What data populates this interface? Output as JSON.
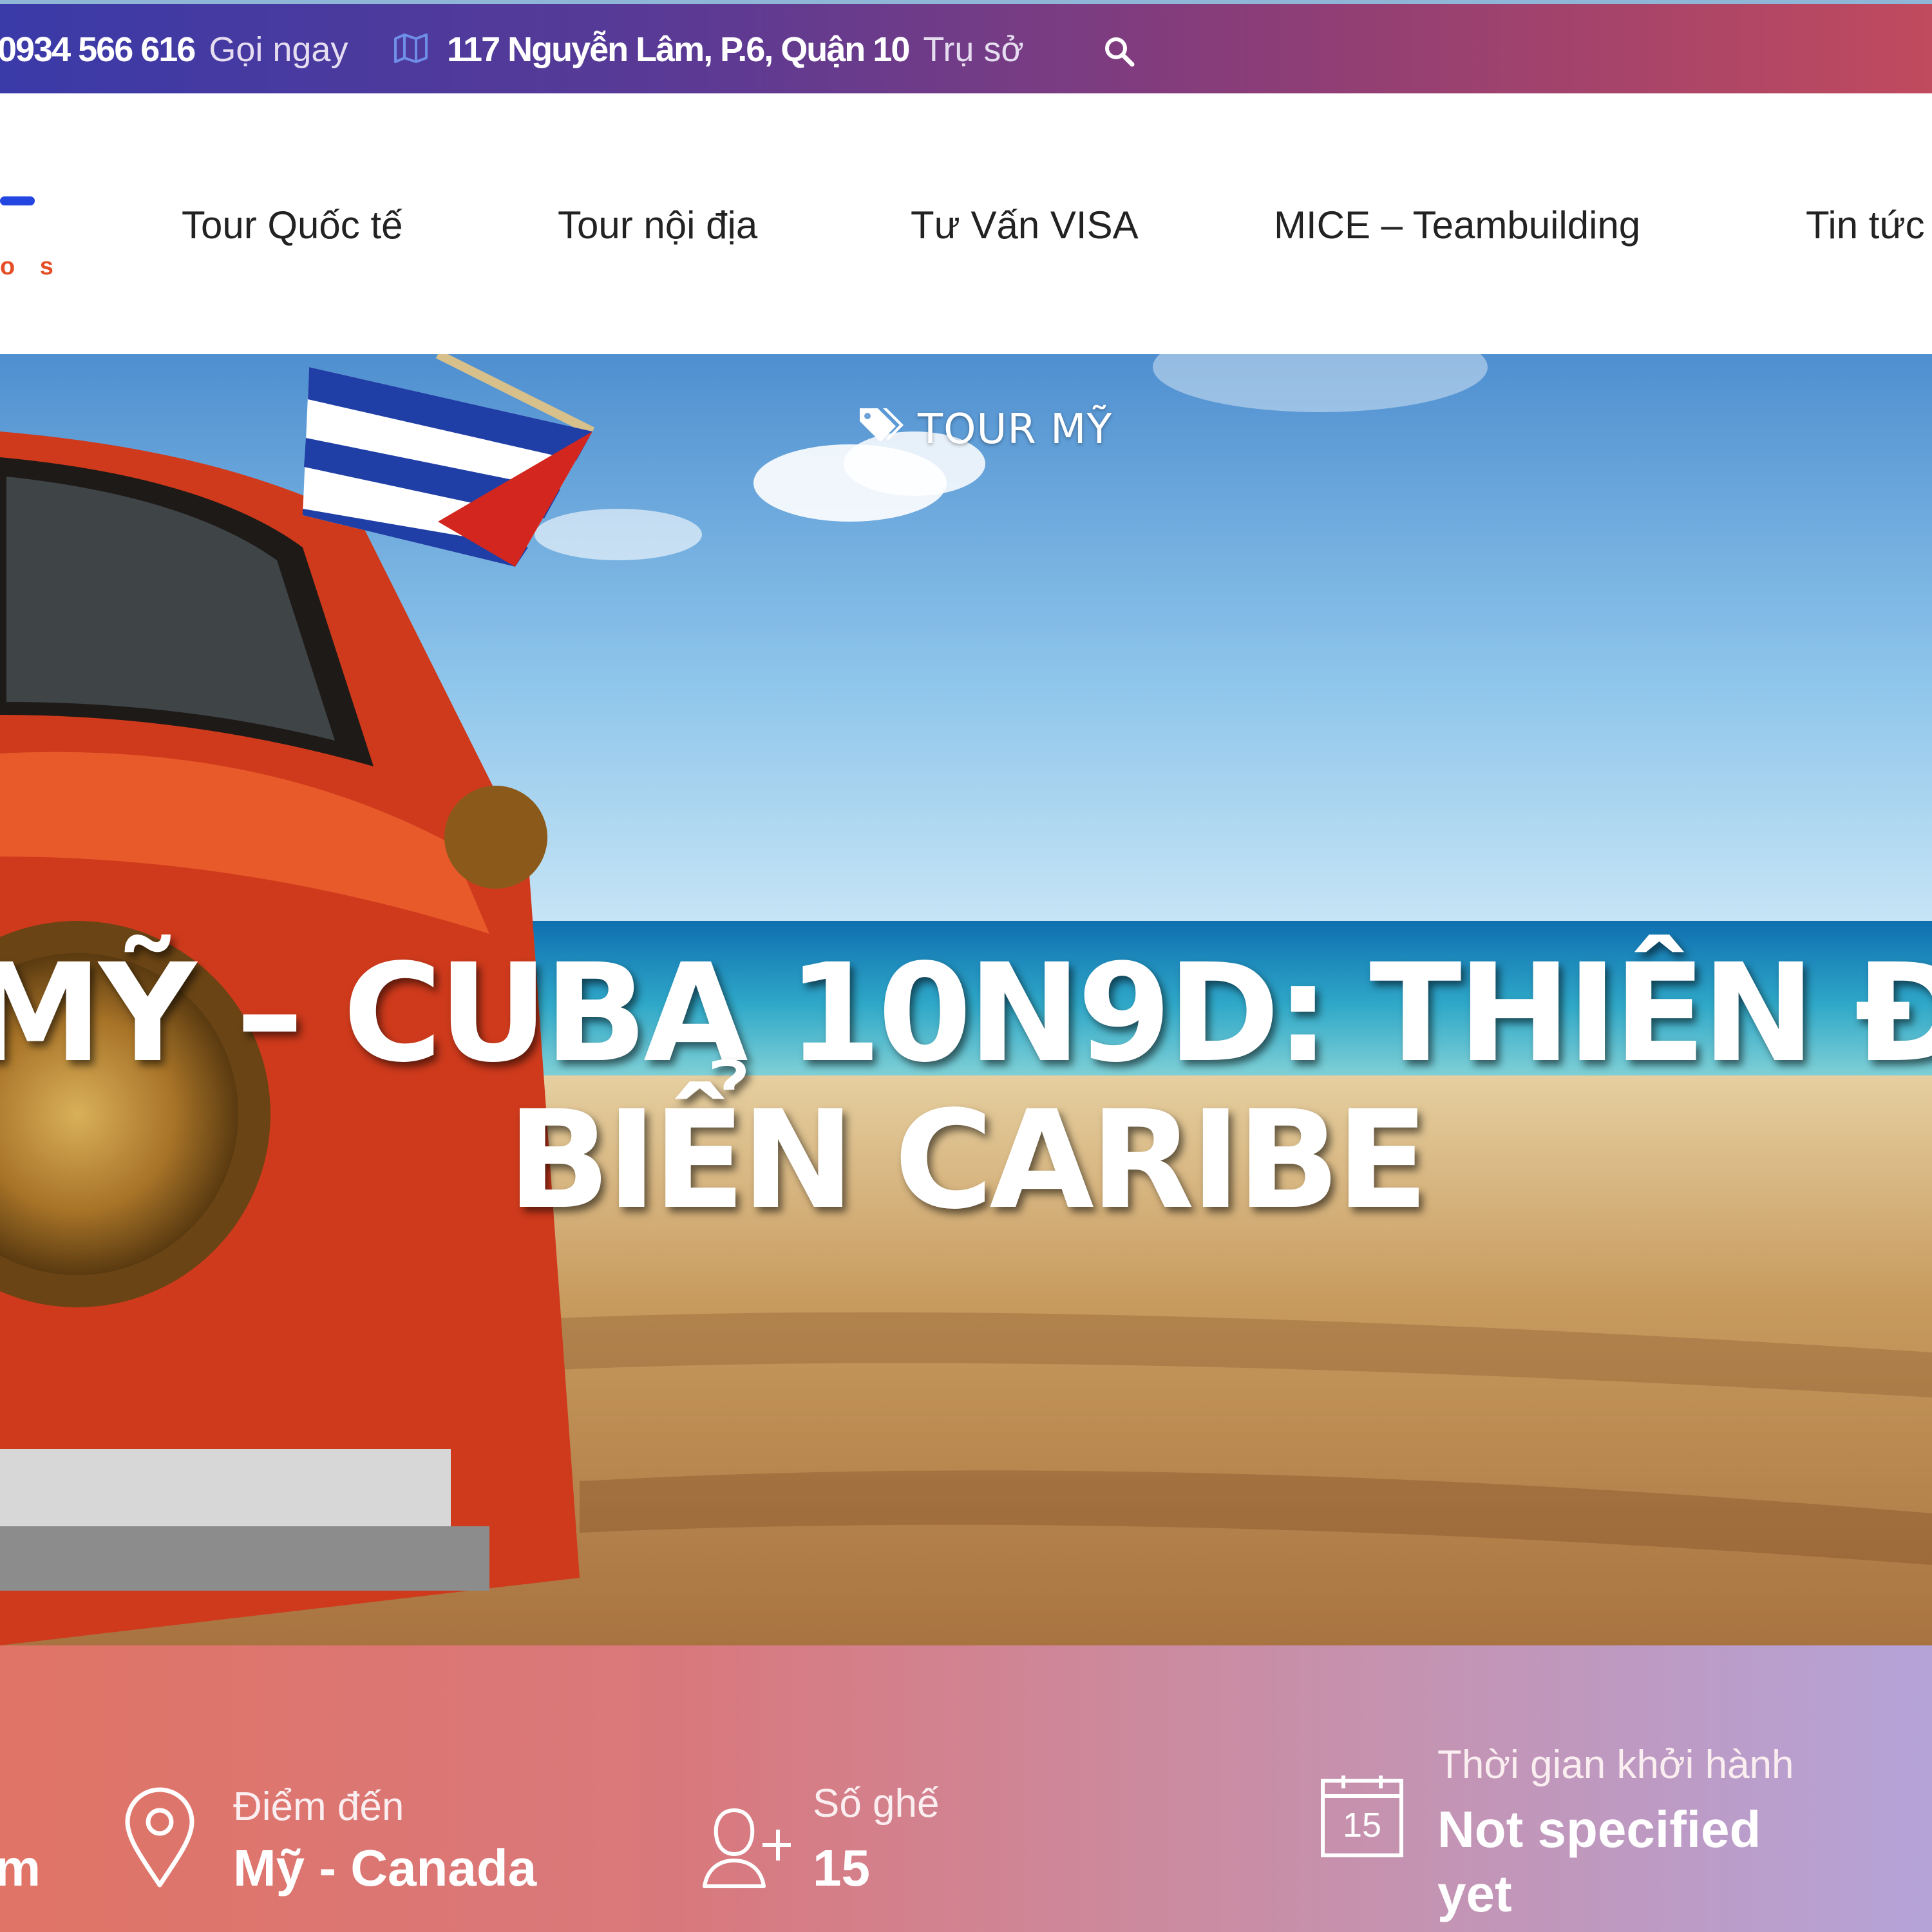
{
  "topbar": {
    "phone": "0934 566 616",
    "phone_action": "Gọi ngay",
    "address": "117 Nguyễn Lâm, P.6, Quận 10",
    "address_label": "Trụ sở",
    "map_icon": "map-icon",
    "search_icon": "search-icon"
  },
  "logo": {
    "letters": "o s"
  },
  "nav": {
    "items": [
      {
        "label": "Tour Quốc tế"
      },
      {
        "label": "Tour nội địa"
      },
      {
        "label": "Tư Vấn VISA"
      },
      {
        "label": "MICE – Teambuilding"
      },
      {
        "label": "Tin tức"
      }
    ]
  },
  "hero": {
    "tag_icon": "tags-icon",
    "tag": "TOUR MỸ",
    "title_line1": "MỸ – CUBA 10N9D: THIÊN Đ",
    "title_line2": "BIỂN CARIBE"
  },
  "info": {
    "partial_value": "m",
    "destination": {
      "icon": "map-pin-icon",
      "label": "Điểm đến",
      "value": "Mỹ - Canada"
    },
    "seats": {
      "icon": "add-user-icon",
      "label": "Số ghế",
      "value": "15"
    },
    "departure": {
      "icon": "calendar-icon",
      "calendar_day": "15",
      "label": "Thời gian khởi hành",
      "value_line1": "Not specified",
      "value_line2": "yet"
    }
  },
  "colors": {
    "topbar_start": "#3a3aa8",
    "topbar_end": "#c04a5e",
    "logo_blue": "#2446e0",
    "logo_orange": "#e44d26",
    "info_start": "#e07466",
    "info_end": "#b5a3d8"
  }
}
